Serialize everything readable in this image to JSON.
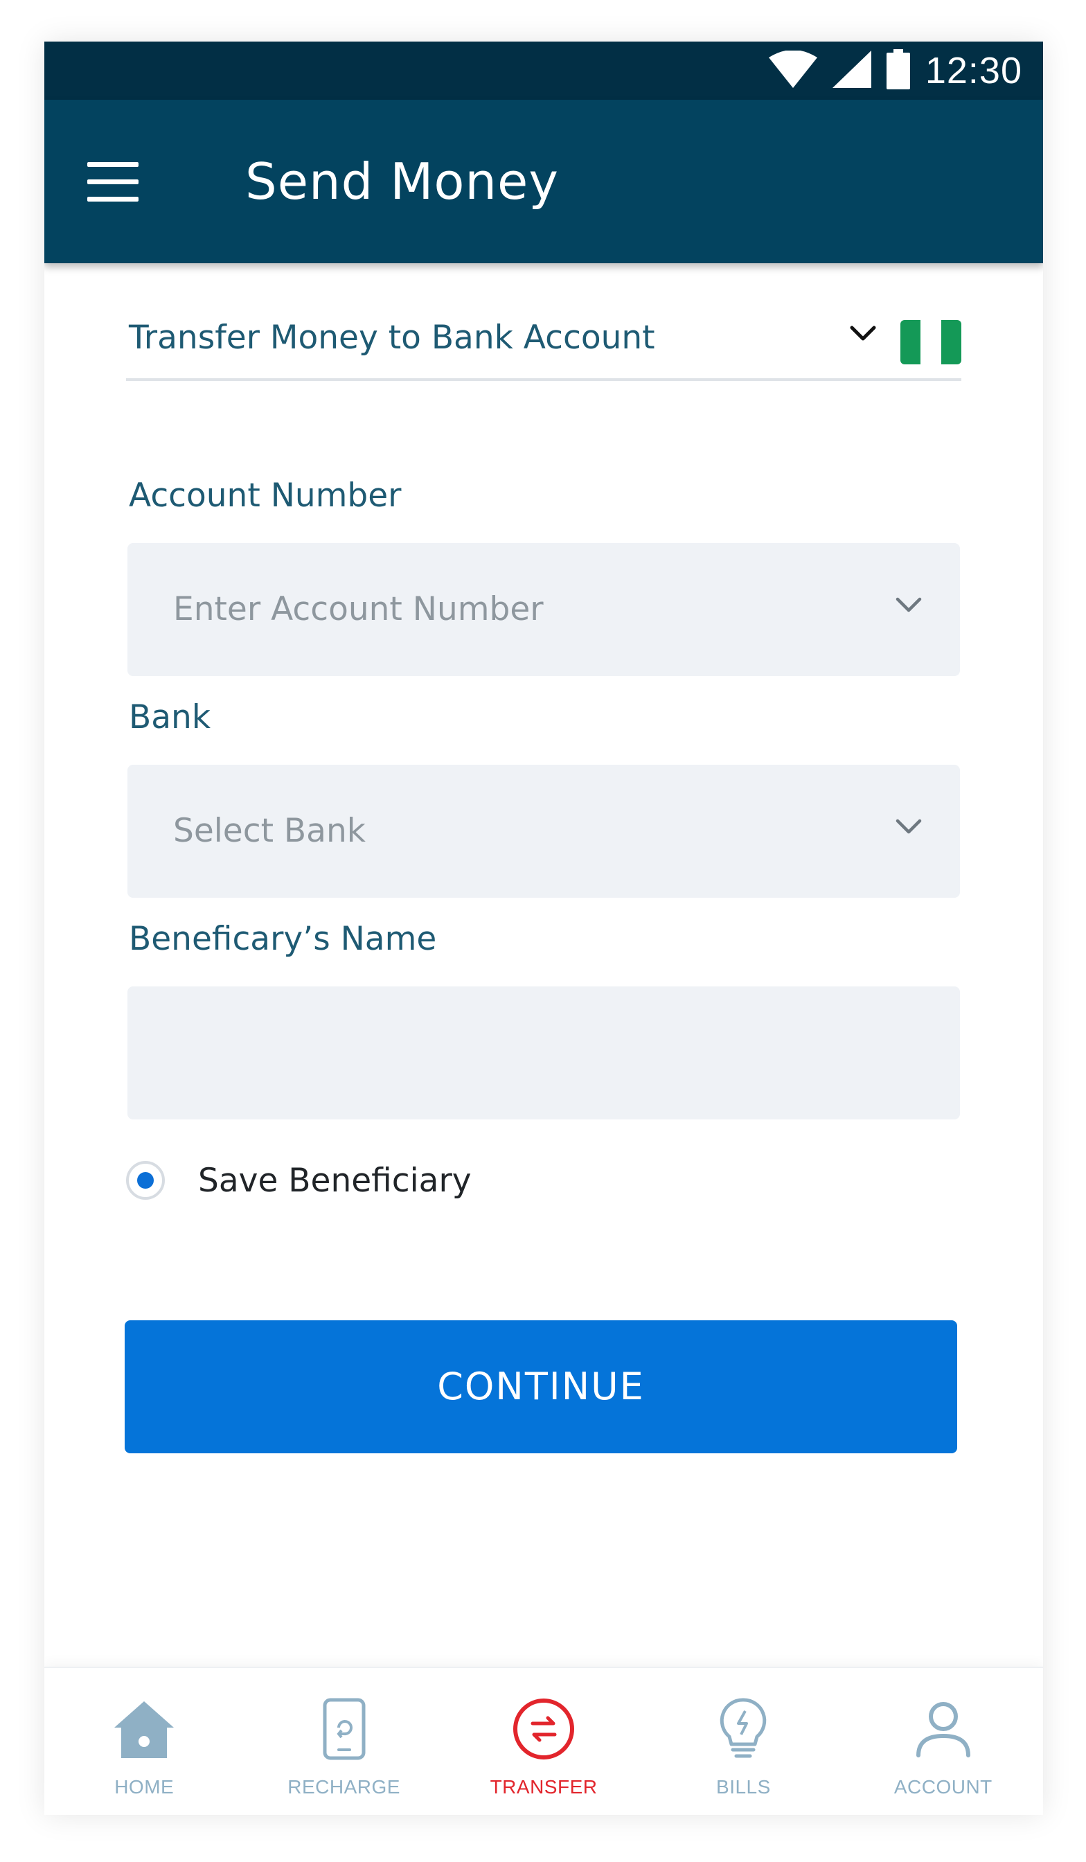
{
  "status_bar": {
    "time": "12:30",
    "icons": [
      "wifi-icon",
      "cellular-signal-icon",
      "battery-icon"
    ]
  },
  "app_bar": {
    "title": "Send Money",
    "menu_icon": "hamburger-menu-icon"
  },
  "transfer_type": {
    "selected": "Transfer Money to Bank Account",
    "country_flag": "nigeria-flag-icon"
  },
  "form": {
    "account_number": {
      "label": "Account Number",
      "placeholder": "Enter Account Number",
      "value": ""
    },
    "bank": {
      "label": "Bank",
      "placeholder": "Select Bank",
      "value": ""
    },
    "beneficiary_name": {
      "label": "Beneficary’s Name",
      "value": ""
    },
    "save_beneficiary": {
      "label": "Save Beneficiary",
      "checked": true
    },
    "continue_label": "CONTINUE"
  },
  "bottom_nav": {
    "items": [
      {
        "label": "HOME",
        "icon": "home-icon",
        "active": false
      },
      {
        "label": "RECHARGE",
        "icon": "phone-recharge-icon",
        "active": false
      },
      {
        "label": "TRANSFER",
        "icon": "transfer-icon",
        "active": true
      },
      {
        "label": "BILLS",
        "icon": "lightbulb-icon",
        "active": false
      },
      {
        "label": "ACCOUNT",
        "icon": "user-icon",
        "active": false
      }
    ]
  },
  "colors": {
    "status_bar": "#022f45",
    "app_bar": "#03435f",
    "label_text": "#1e5a73",
    "field_bg": "#eff2f6",
    "primary_button": "#0574d9",
    "nav_inactive": "#8fb0c5",
    "nav_active": "#e2252c",
    "flag_green": "#149957"
  }
}
